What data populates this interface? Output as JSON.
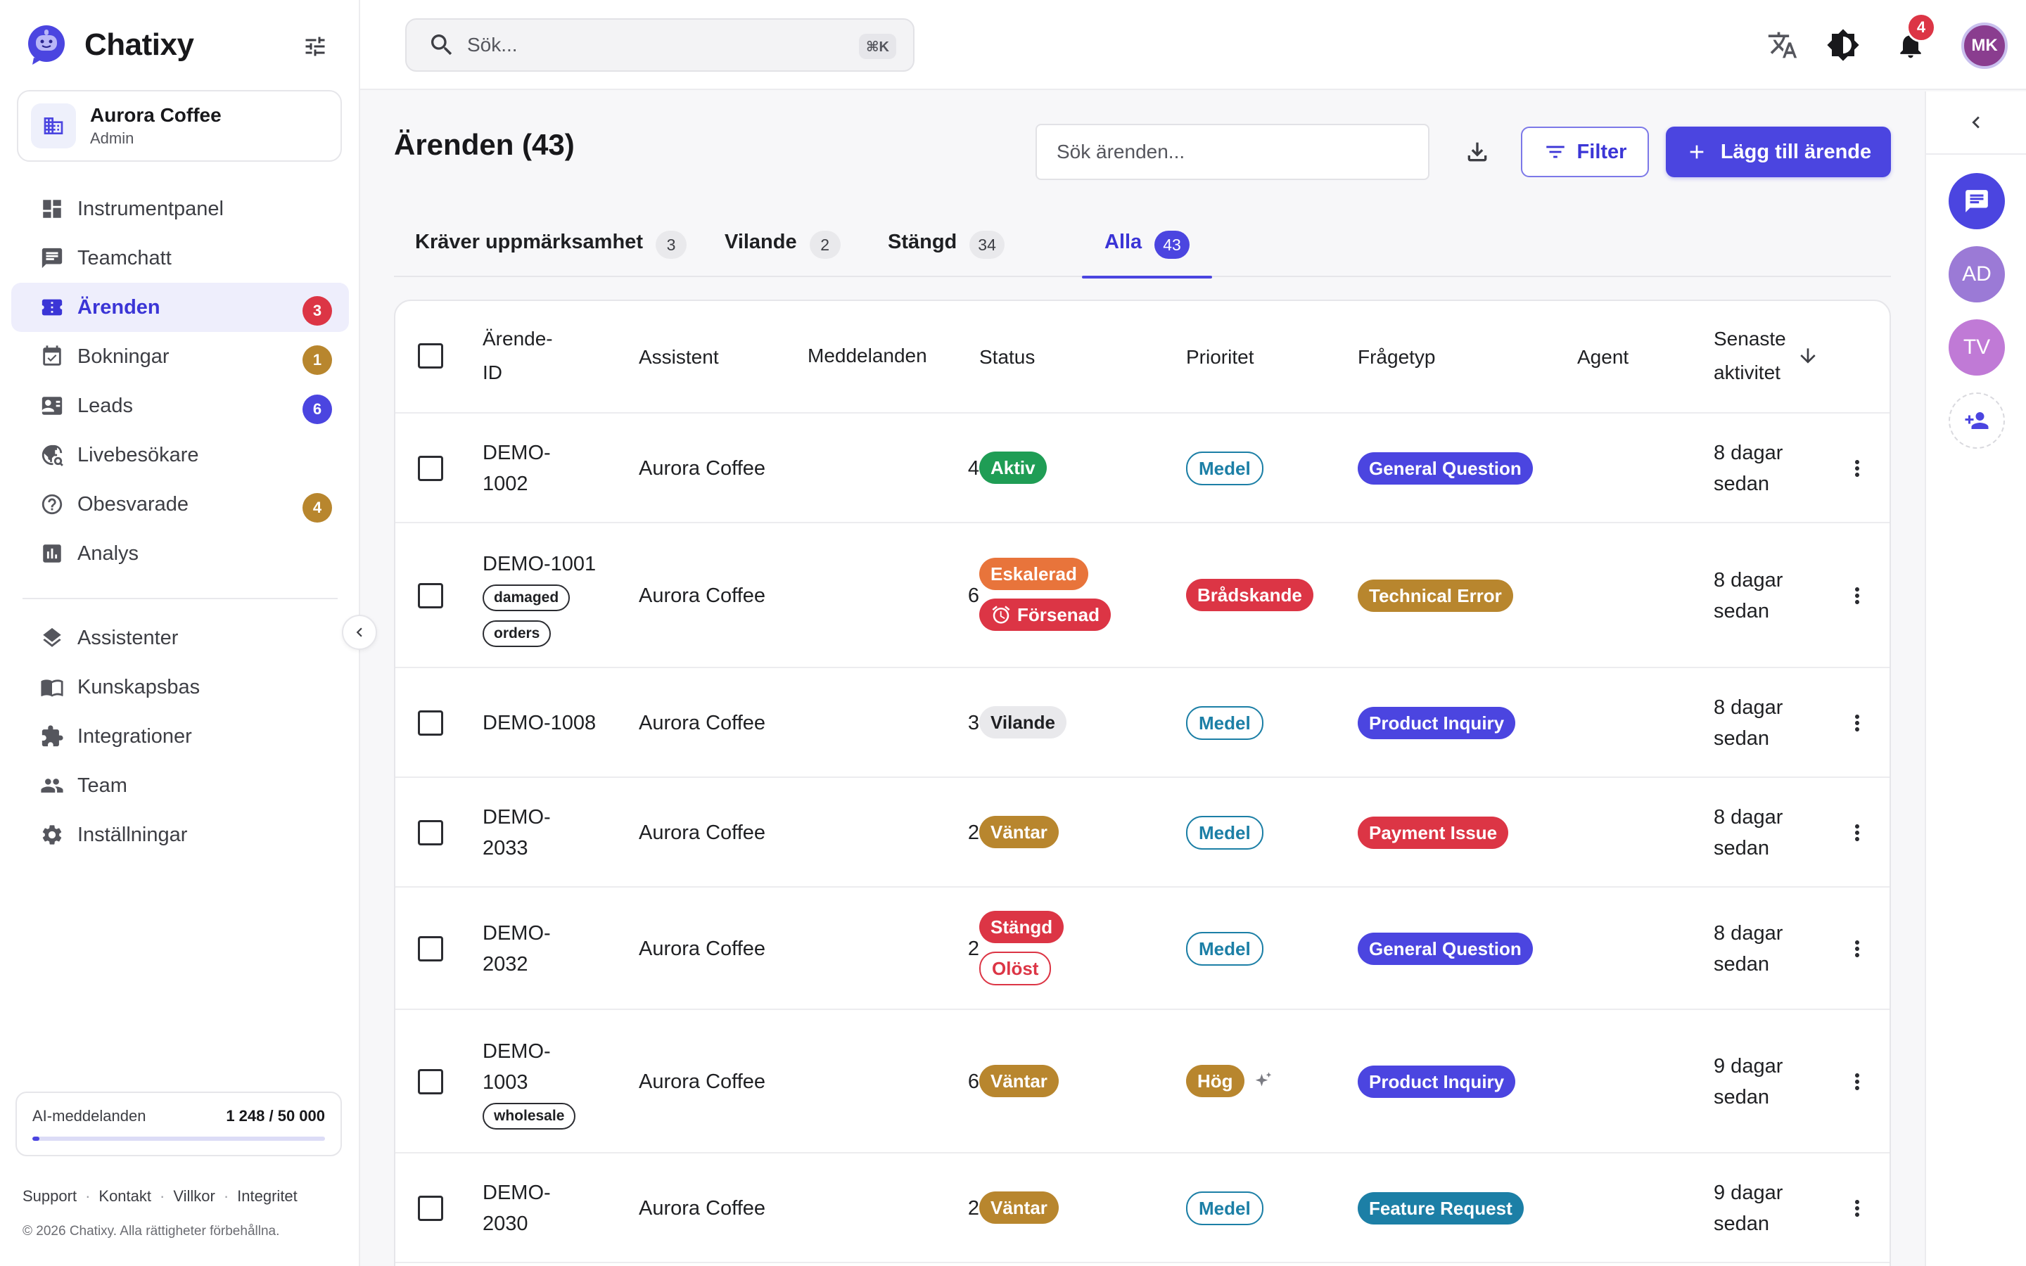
{
  "app": {
    "name": "Chatixy"
  },
  "workspace": {
    "name": "Aurora Coffee",
    "role": "Admin"
  },
  "sidebar": {
    "items": [
      {
        "label": "Instrumentpanel",
        "icon": "dashboard-icon"
      },
      {
        "label": "Teamchatt",
        "icon": "chat-icon"
      },
      {
        "label": "Ärenden",
        "icon": "ticket-icon",
        "badge": "3",
        "badge_color": "#dc3545",
        "active": true
      },
      {
        "label": "Bokningar",
        "icon": "calendar-icon",
        "badge": "1",
        "badge_color": "#b8862e"
      },
      {
        "label": "Leads",
        "icon": "contact-card-icon",
        "badge": "6",
        "badge_color": "#4b45e0"
      },
      {
        "label": "Livebesökare",
        "icon": "live-visitor-icon"
      },
      {
        "label": "Obesvarade",
        "icon": "question-icon",
        "badge": "4",
        "badge_color": "#b8862e"
      },
      {
        "label": "Analys",
        "icon": "analytics-icon"
      }
    ],
    "items2": [
      {
        "label": "Assistenter",
        "icon": "layers-icon"
      },
      {
        "label": "Kunskapsbas",
        "icon": "book-icon"
      },
      {
        "label": "Integrationer",
        "icon": "puzzle-icon"
      },
      {
        "label": "Team",
        "icon": "people-icon"
      },
      {
        "label": "Inställningar",
        "icon": "gear-icon"
      }
    ],
    "usage": {
      "label": "AI-meddelanden",
      "value": "1 248 / 50 000",
      "fraction": 0.025
    },
    "footer": {
      "support": "Support",
      "contact": "Kontakt",
      "terms": "Villkor",
      "privacy": "Integritet",
      "separator": "·"
    },
    "copyright": "© 2026 Chatixy. Alla rättigheter förbehållna."
  },
  "topbar": {
    "search_placeholder": "Sök...",
    "shortcut": "⌘K",
    "notifications": "4",
    "user_initials": "MK"
  },
  "page": {
    "title": "Ärenden (43)",
    "search_placeholder": "Sök ärenden...",
    "filter_label": "Filter",
    "add_label": "Lägg till ärende"
  },
  "tabs": [
    {
      "label": "Kräver uppmärksamhet",
      "count": "3"
    },
    {
      "label": "Vilande",
      "count": "2"
    },
    {
      "label": "Stängd",
      "count": "34"
    },
    {
      "label": "Alla",
      "count": "43",
      "active": true
    }
  ],
  "table": {
    "headers": {
      "id_line1": "Ärende-",
      "id_line2": "ID",
      "assistant": "Assistent",
      "messages": "Meddelanden",
      "status": "Status",
      "priority": "Prioritet",
      "question_type": "Frågetyp",
      "agent": "Agent",
      "activity_line1": "Senaste",
      "activity_line2": "aktivitet"
    },
    "rows": [
      {
        "id1": "DEMO-",
        "id2": "1002",
        "tags": [],
        "assistant": "Aurora Coffee",
        "messages": "4",
        "statuses": [
          {
            "label": "Aktiv",
            "style": "fill",
            "color": "#1f9d55"
          }
        ],
        "priority": {
          "label": "Medel",
          "style": "outline",
          "color": "#1c7fa6"
        },
        "qtype": {
          "label": "General Question",
          "color": "#4b45e0"
        },
        "act1": "8 dagar",
        "act2": "sedan"
      },
      {
        "id1": "DEMO-1001",
        "id2": "",
        "tags": [
          "damaged",
          "orders"
        ],
        "assistant": "Aurora Coffee",
        "messages": "6",
        "statuses": [
          {
            "label": "Eskalerad",
            "style": "fill",
            "color": "#e8743b"
          },
          {
            "label": "Försenad",
            "style": "fill-alarm",
            "color": "#dc3545"
          }
        ],
        "priority": {
          "label": "Brådskande",
          "style": "fill",
          "color": "#dc3545"
        },
        "qtype": {
          "label": "Technical Error",
          "color": "#b8862e"
        },
        "act1": "8 dagar",
        "act2": "sedan"
      },
      {
        "id1": "DEMO-1008",
        "id2": "",
        "tags": [],
        "assistant": "Aurora Coffee",
        "messages": "3",
        "statuses": [
          {
            "label": "Vilande",
            "style": "grey",
            "color": "#e9e9ec"
          }
        ],
        "priority": {
          "label": "Medel",
          "style": "outline",
          "color": "#1c7fa6"
        },
        "qtype": {
          "label": "Product Inquiry",
          "color": "#4b45e0"
        },
        "act1": "8 dagar",
        "act2": "sedan"
      },
      {
        "id1": "DEMO-",
        "id2": "2033",
        "tags": [],
        "assistant": "Aurora Coffee",
        "messages": "2",
        "statuses": [
          {
            "label": "Väntar",
            "style": "fill",
            "color": "#b8862e"
          }
        ],
        "priority": {
          "label": "Medel",
          "style": "outline",
          "color": "#1c7fa6"
        },
        "qtype": {
          "label": "Payment Issue",
          "color": "#dc3545"
        },
        "act1": "8 dagar",
        "act2": "sedan"
      },
      {
        "id1": "DEMO-",
        "id2": "2032",
        "tags": [],
        "assistant": "Aurora Coffee",
        "messages": "2",
        "statuses": [
          {
            "label": "Stängd",
            "style": "fill",
            "color": "#dc3545"
          },
          {
            "label": "Olöst",
            "style": "outline",
            "color": "#dc3545"
          }
        ],
        "priority": {
          "label": "Medel",
          "style": "outline",
          "color": "#1c7fa6"
        },
        "qtype": {
          "label": "General Question",
          "color": "#4b45e0"
        },
        "act1": "8 dagar",
        "act2": "sedan"
      },
      {
        "id1": "DEMO-",
        "id2": "1003",
        "tags": [
          "wholesale"
        ],
        "assistant": "Aurora Coffee",
        "messages": "6",
        "statuses": [
          {
            "label": "Väntar",
            "style": "fill",
            "color": "#b8862e"
          }
        ],
        "priority": {
          "label": "Hög",
          "style": "fill-sparkle",
          "color": "#b8862e"
        },
        "qtype": {
          "label": "Product Inquiry",
          "color": "#4b45e0"
        },
        "act1": "9 dagar",
        "act2": "sedan"
      },
      {
        "id1": "DEMO-",
        "id2": "2030",
        "tags": [],
        "assistant": "Aurora Coffee",
        "messages": "2",
        "statuses": [
          {
            "label": "Väntar",
            "style": "fill",
            "color": "#b8862e"
          }
        ],
        "priority": {
          "label": "Medel",
          "style": "outline",
          "color": "#1c7fa6"
        },
        "qtype": {
          "label": "Feature Request",
          "color": "#1c7fa6"
        },
        "act1": "9 dagar",
        "act2": "sedan"
      }
    ]
  },
  "rail": {
    "avatars": [
      {
        "initials": "AD",
        "color": "#9b7ad6"
      },
      {
        "initials": "TV",
        "color": "#c07ad6"
      }
    ]
  }
}
